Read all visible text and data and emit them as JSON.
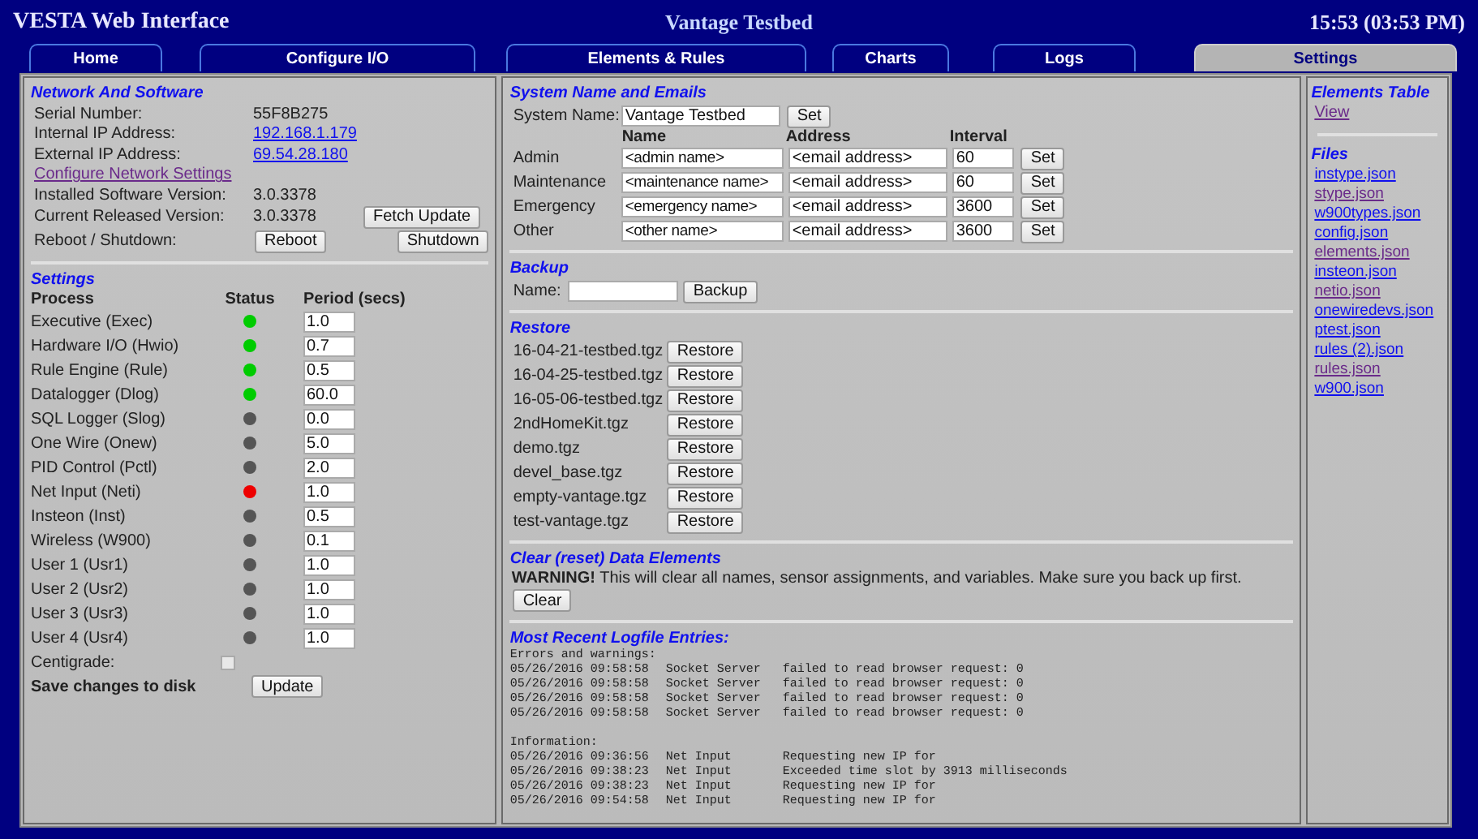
{
  "header": {
    "title": "VESTA Web Interface",
    "system": "Vantage Testbed",
    "time": "15:53 (03:53 PM)"
  },
  "tabs": [
    {
      "label": "Home",
      "selected": false
    },
    {
      "label": "Configure I/O",
      "selected": false
    },
    {
      "label": "Elements & Rules",
      "selected": false
    },
    {
      "label": "Charts",
      "selected": false
    },
    {
      "label": "Logs",
      "selected": false
    },
    {
      "label": "Settings",
      "selected": true
    }
  ],
  "network": {
    "heading": "Network And Software",
    "rows": [
      {
        "label": "Serial Number:",
        "value": "55F8B275",
        "kind": "text"
      },
      {
        "label": "Internal IP Address:",
        "value": "192.168.1.179",
        "kind": "link"
      },
      {
        "label": "External IP Address:",
        "value": "69.54.28.180",
        "kind": "link"
      }
    ],
    "configure_link": "Configure Network Settings",
    "installed_label": "Installed Software Version:",
    "installed": "3.0.3378",
    "released_label": "Current Released Version:",
    "released": "3.0.3378",
    "fetch_button": "Fetch Update",
    "reboot_label": "Reboot / Shutdown:",
    "reboot_button": "Reboot",
    "shutdown_button": "Shutdown"
  },
  "settings": {
    "heading": "Settings",
    "columns": [
      "Process",
      "Status",
      "Period (secs)"
    ],
    "processes": [
      {
        "name": "Executive (Exec)",
        "color": "#00cc00",
        "period": "1.0"
      },
      {
        "name": "Hardware I/O (Hwio)",
        "color": "#00cc00",
        "period": "0.7"
      },
      {
        "name": "Rule Engine (Rule)",
        "color": "#00cc00",
        "period": "0.5"
      },
      {
        "name": "Datalogger (Dlog)",
        "color": "#00cc00",
        "period": "60.0"
      },
      {
        "name": "SQL Logger (Slog)",
        "color": "#555555",
        "period": "0.0"
      },
      {
        "name": "One Wire (Onew)",
        "color": "#555555",
        "period": "5.0"
      },
      {
        "name": "PID Control (Pctl)",
        "color": "#555555",
        "period": "2.0"
      },
      {
        "name": "Net Input (Neti)",
        "color": "#ee0000",
        "period": "1.0"
      },
      {
        "name": "Insteon (Inst)",
        "color": "#555555",
        "period": "0.5"
      },
      {
        "name": "Wireless (W900)",
        "color": "#555555",
        "period": "0.1"
      },
      {
        "name": "User 1 (Usr1)",
        "color": "#555555",
        "period": "1.0"
      },
      {
        "name": "User 2 (Usr2)",
        "color": "#555555",
        "period": "1.0"
      },
      {
        "name": "User 3 (Usr3)",
        "color": "#555555",
        "period": "1.0"
      },
      {
        "name": "User 4 (Usr4)",
        "color": "#555555",
        "period": "1.0"
      }
    ],
    "centigrade_label": "Centigrade:",
    "centigrade_checked": false,
    "save_label": "Save changes to disk",
    "update_button": "Update"
  },
  "system": {
    "heading": "System Name and Emails",
    "name_label": "System Name:",
    "name_value": "Vantage Testbed",
    "set_button": "Set",
    "columns": [
      "Name",
      "Address",
      "Interval"
    ],
    "contacts": [
      {
        "role": "Admin",
        "name": "<admin name>",
        "address": "<email address>",
        "interval": "60",
        "button": "Set"
      },
      {
        "role": "Maintenance",
        "name": "<maintenance name>",
        "address": "<email address>",
        "interval": "60",
        "button": "Set"
      },
      {
        "role": "Emergency",
        "name": "<emergency name>",
        "address": "<email address>",
        "interval": "3600",
        "button": "Set"
      },
      {
        "role": "Other",
        "name": "<other name>",
        "address": "<email address>",
        "interval": "3600",
        "button": "Set"
      }
    ]
  },
  "backup": {
    "heading": "Backup",
    "label": "Name:",
    "button": "Backup"
  },
  "restore": {
    "heading": "Restore",
    "files": [
      {
        "name": "16-04-21-testbed.tgz",
        "button": "Restore"
      },
      {
        "name": "16-04-25-testbed.tgz",
        "button": "Restore"
      },
      {
        "name": "16-05-06-testbed.tgz",
        "button": "Restore"
      },
      {
        "name": "2ndHomeKit.tgz",
        "button": "Restore"
      },
      {
        "name": "demo.tgz",
        "button": "Restore"
      },
      {
        "name": "devel_base.tgz",
        "button": "Restore"
      },
      {
        "name": "empty-vantage.tgz",
        "button": "Restore"
      },
      {
        "name": "test-vantage.tgz",
        "button": "Restore"
      }
    ]
  },
  "clear": {
    "heading": "Clear (reset) Data Elements",
    "warning": "**WARNING!** This will clear all names, sensor assignments, and variables. Make sure you back up first.",
    "button": "Clear"
  },
  "log": {
    "heading": "Most Recent Logfile Entries:",
    "groups": [
      {
        "title": "Errors and warnings:",
        "entries": [
          {
            "time": "05/26/2016 09:58:58",
            "source": "Socket Server",
            "message": "failed to read browser request: 0"
          },
          {
            "time": "05/26/2016 09:58:58",
            "source": "Socket Server",
            "message": "failed to read browser request: 0"
          },
          {
            "time": "05/26/2016 09:58:58",
            "source": "Socket Server",
            "message": "failed to read browser request: 0"
          },
          {
            "time": "05/26/2016 09:58:58",
            "source": "Socket Server",
            "message": "failed to read browser request: 0"
          }
        ]
      },
      {
        "title": "Information:",
        "entries": [
          {
            "time": "05/26/2016 09:36:56",
            "source": "Net Input",
            "message": "Requesting new IP for"
          },
          {
            "time": "05/26/2016 09:38:23",
            "source": "Net Input",
            "message": "Exceeded time slot by 3913 milliseconds"
          },
          {
            "time": "05/26/2016 09:38:23",
            "source": "Net Input",
            "message": "Requesting new IP for"
          },
          {
            "time": "05/26/2016 09:54:58",
            "source": "Net Input",
            "message": "Requesting new IP for"
          }
        ]
      }
    ]
  },
  "sidebar": {
    "elements_heading": "Elements Table",
    "view_link": {
      "label": "View",
      "visited": true
    },
    "files_heading": "Files",
    "files": [
      {
        "label": "instype.json",
        "visited": false
      },
      {
        "label": "stype.json",
        "visited": true
      },
      {
        "label": "w900types.json",
        "visited": false
      },
      {
        "label": "config.json",
        "visited": false
      },
      {
        "label": "elements.json",
        "visited": true
      },
      {
        "label": "insteon.json",
        "visited": false
      },
      {
        "label": "netio.json",
        "visited": true
      },
      {
        "label": "onewiredevs.json",
        "visited": false
      },
      {
        "label": "ptest.json",
        "visited": false
      },
      {
        "label": "rules (2).json",
        "visited": false
      },
      {
        "label": "rules.json",
        "visited": true
      },
      {
        "label": "w900.json",
        "visited": false
      }
    ]
  }
}
